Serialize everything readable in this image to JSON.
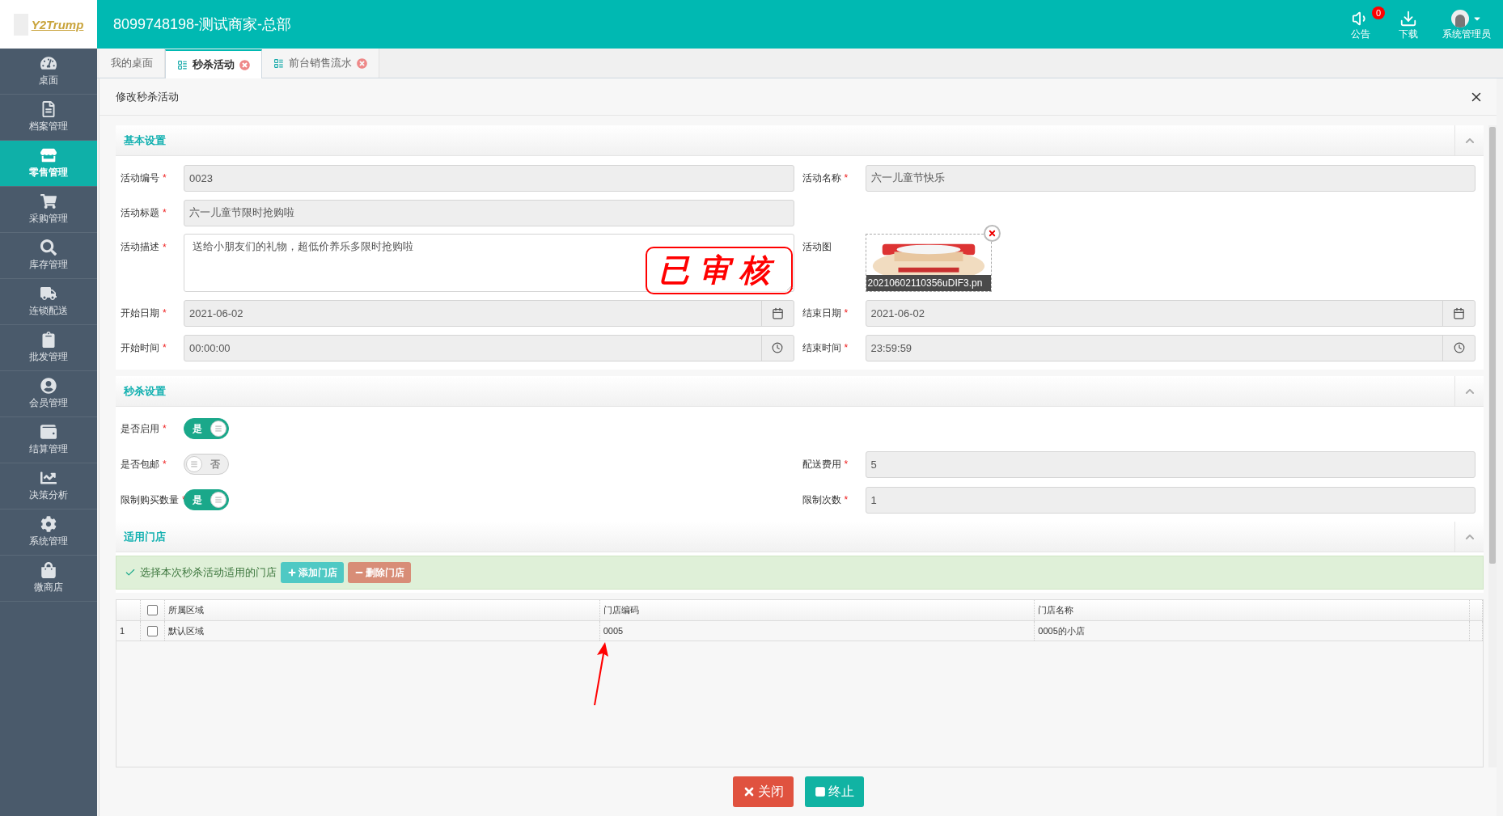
{
  "header": {
    "logo": "Y2Trump",
    "title": "8099748198-测试商家-总部",
    "notice": {
      "label": "公告",
      "badge": "0"
    },
    "download": "下载",
    "user": "系统管理员"
  },
  "sidebar": [
    {
      "label": "桌面",
      "selected": false
    },
    {
      "label": "档案管理",
      "selected": false
    },
    {
      "label": "零售管理",
      "selected": true
    },
    {
      "label": "采购管理",
      "selected": false
    },
    {
      "label": "库存管理",
      "selected": false
    },
    {
      "label": "连锁配送",
      "selected": false
    },
    {
      "label": "批发管理",
      "selected": false
    },
    {
      "label": "会员管理",
      "selected": false
    },
    {
      "label": "结算管理",
      "selected": false
    },
    {
      "label": "决策分析",
      "selected": false
    },
    {
      "label": "系统管理",
      "selected": false
    },
    {
      "label": "微商店",
      "selected": false
    }
  ],
  "tabs": [
    {
      "label": "我的桌面",
      "selected": false,
      "closable": false
    },
    {
      "label": "秒杀活动",
      "selected": true,
      "closable": true
    },
    {
      "label": "前台销售流水",
      "selected": false,
      "closable": true
    }
  ],
  "dialog": {
    "title": "修改秒杀活动",
    "basic": {
      "title": "基本设置",
      "stamp": "已审核",
      "rows": [
        {
          "cells": [
            {
              "kind": "text",
              "label": "活动编号",
              "mark": "*",
              "value": "0023"
            },
            {
              "kind": "text",
              "label": "活动名称",
              "mark": "*",
              "value": "六一儿童节快乐"
            }
          ]
        },
        {
          "cells": [
            {
              "kind": "text",
              "label": "活动标题",
              "mark": "*",
              "value": "六一儿童节限时抢购啦"
            }
          ]
        },
        {
          "cells": [
            {
              "kind": "textarea",
              "label": "活动描述",
              "mark": "*",
              "value": "送给小朋友们的礼物，超低价养乐多限时抢购啦"
            },
            {
              "label": "活动图",
              "value": "20210602110356uDIF3.pn"
            }
          ]
        },
        {
          "cells": [
            {
              "kind": "date",
              "label": "开始日期",
              "mark": "*",
              "value": "2021-06-02"
            },
            {
              "kind": "date",
              "label": "结束日期",
              "mark": "*",
              "value": "2021-06-02"
            }
          ]
        },
        {
          "cells": [
            {
              "kind": "time",
              "label": "开始时间",
              "mark": "*",
              "value": "00:00:00"
            },
            {
              "kind": "time",
              "label": "结束时间",
              "mark": "*",
              "value": "23:59:59"
            }
          ]
        }
      ]
    },
    "seckill": {
      "title": "秒杀设置",
      "rows": [
        {
          "cells": [
            {
              "kind": "switch",
              "label": "是否启用",
              "mark": "*",
              "on": true,
              "value": "是"
            }
          ]
        },
        {
          "cells": [
            {
              "kind": "switch",
              "label": "是否包邮",
              "mark": "*",
              "on": false,
              "value": "否"
            },
            {
              "kind": "text",
              "label": "配送费用",
              "mark": "*",
              "value": "5"
            }
          ]
        },
        {
          "cells": [
            {
              "kind": "switch",
              "label": "限制购买数量",
              "mark": "*",
              "on": true,
              "value": "是"
            },
            {
              "kind": "text",
              "label": "限制次数",
              "mark": "*",
              "value": "1"
            }
          ]
        }
      ]
    },
    "stores": {
      "title": "适用门店",
      "hint": "选择本次秒杀活动适用的门店",
      "add": "添加门店",
      "remove": "删除门店",
      "columns": [
        "所属区域",
        "门店编码",
        "门店名称"
      ],
      "all_checked": false,
      "rows": [
        {
          "index": "1",
          "checked": false,
          "cells": [
            "默认区域",
            "0005",
            "0005的小店"
          ]
        }
      ]
    },
    "buttons": {
      "close": "关闭",
      "stop": "终止"
    }
  }
}
